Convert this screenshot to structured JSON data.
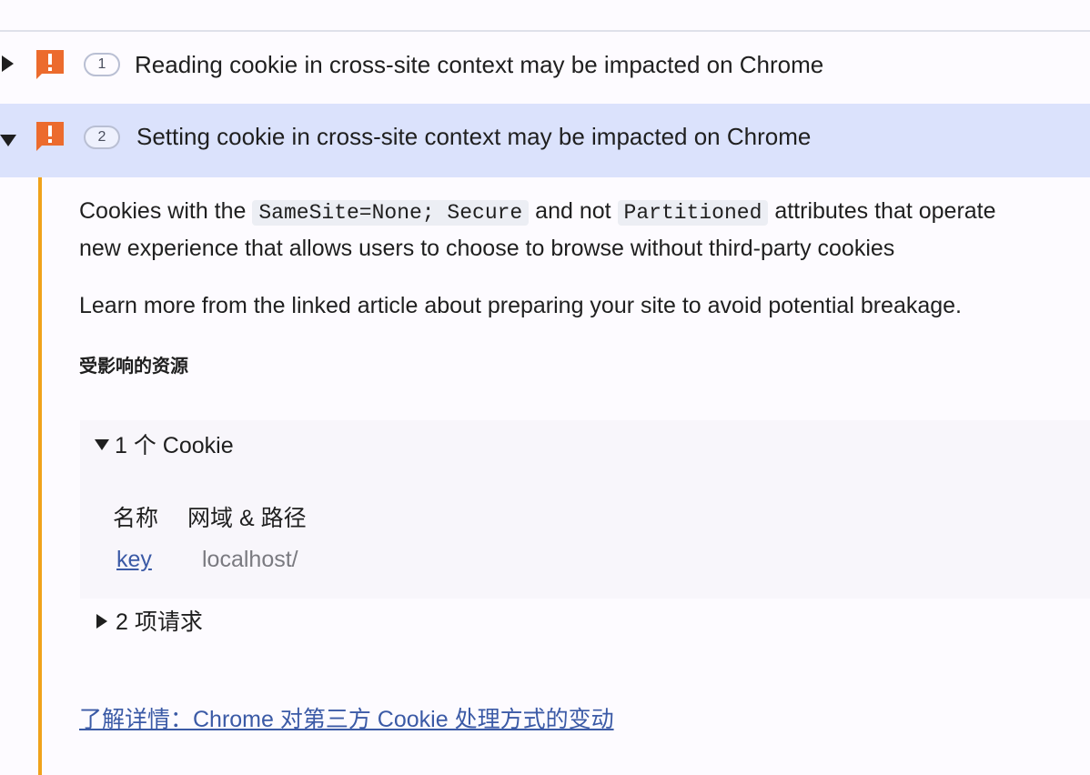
{
  "issues": [
    {
      "count": "1",
      "title": "Reading cookie in cross-site context may be impacted on Chrome",
      "expanded": false
    },
    {
      "count": "2",
      "title": "Setting cookie in cross-site context may be impacted on Chrome",
      "expanded": true
    }
  ],
  "details": {
    "p1_prefix": "Cookies with the ",
    "p1_code1": "SameSite=None; Secure",
    "p1_mid": " and not ",
    "p1_code2": "Partitioned",
    "p1_suffix": " attributes that operate",
    "p2": "new experience that allows users to choose to browse without third-party cookies",
    "p3": "Learn more from the linked article about preparing your site to avoid potential breakage.",
    "affected_heading": "受影响的资源",
    "cookies_toggle": "1 个 Cookie",
    "col_name": "名称",
    "col_domain": "网域 & 路径",
    "cookie_name": "key",
    "cookie_domain": "localhost/",
    "requests_toggle": "2 项请求",
    "learn_more": "了解详情：Chrome 对第三方 Cookie 处理方式的变动"
  },
  "colors": {
    "warning": "#ec6b2d",
    "selected_row": "#dbe2fc",
    "rail": "#f0a21b",
    "link": "#3b5aa6"
  }
}
